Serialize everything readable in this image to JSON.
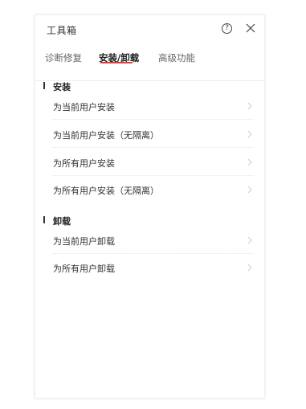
{
  "window": {
    "title": "工具箱",
    "help_glyph": "?"
  },
  "tabs": [
    {
      "label": "诊断修复",
      "active": false
    },
    {
      "label": "安装/卸载",
      "active": true
    },
    {
      "label": "高级功能",
      "active": false
    }
  ],
  "colors": {
    "accent": "#e0403c",
    "text": "#333333",
    "muted": "#666666",
    "chevron": "#cccccc"
  },
  "sections": [
    {
      "label": "安装",
      "items": [
        {
          "label": "为当前用户安装"
        },
        {
          "label": "为当前用户安装（无隔离）"
        },
        {
          "label": "为所有用户安装"
        },
        {
          "label": "为所有用户安装（无隔离）"
        }
      ]
    },
    {
      "label": "卸载",
      "items": [
        {
          "label": "为当前用户卸载"
        },
        {
          "label": "为所有用户卸载"
        }
      ]
    }
  ]
}
